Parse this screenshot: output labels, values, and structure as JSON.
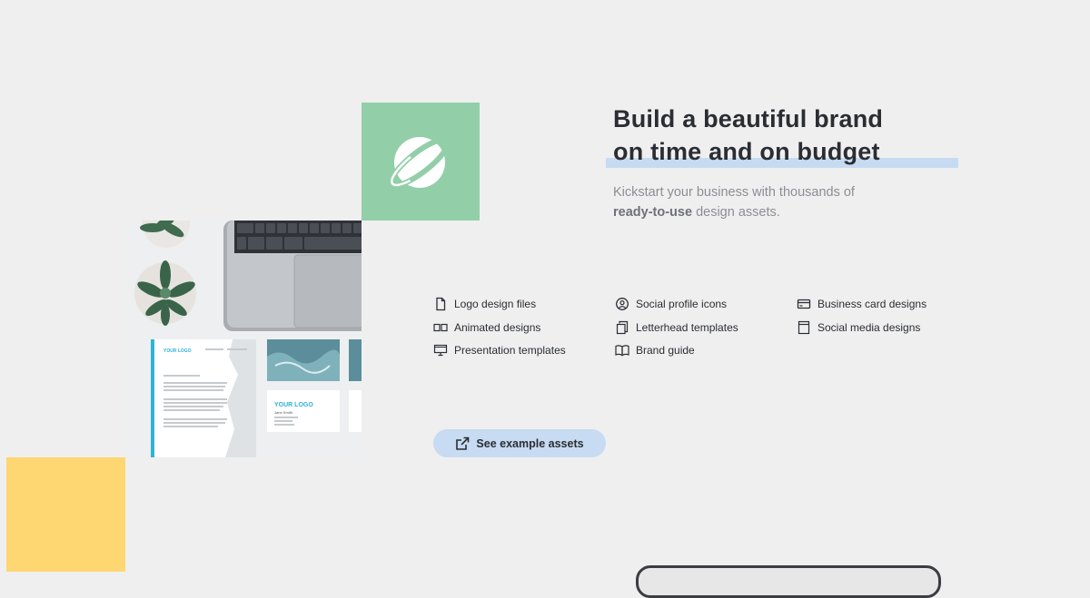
{
  "hero": {
    "title_line1": "Build a beautiful brand",
    "title_line2": "on time and on budget",
    "subtitle_start": "Kickstart your business with thousands of",
    "subtitle_bold": "ready-to-use",
    "subtitle_end": "design assets."
  },
  "features": [
    {
      "label": "Logo design files",
      "icon": "file-icon"
    },
    {
      "label": "Social profile icons",
      "icon": "user-circle-icon"
    },
    {
      "label": "Business card designs",
      "icon": "credit-card-icon"
    },
    {
      "label": "Animated designs",
      "icon": "animation-icon"
    },
    {
      "label": "Letterhead templates",
      "icon": "copy-icon"
    },
    {
      "label": "Social media designs",
      "icon": "window-icon"
    },
    {
      "label": "Presentation templates",
      "icon": "presentation-icon"
    },
    {
      "label": "Brand guide",
      "icon": "book-icon"
    }
  ],
  "cta": {
    "label": "See example assets",
    "icon": "external-link-icon"
  },
  "mockup": {
    "logo_text": "YOUR LOGO",
    "card_logo_text": "YOUR LOGO",
    "card_name": "Jane Smith"
  },
  "colors": {
    "background": "#efefef",
    "green_tile": "#92cfa9",
    "yellow_block": "#fed672",
    "highlight_blue": "#c6dbf2",
    "accent_teal": "#2fb3d6"
  }
}
